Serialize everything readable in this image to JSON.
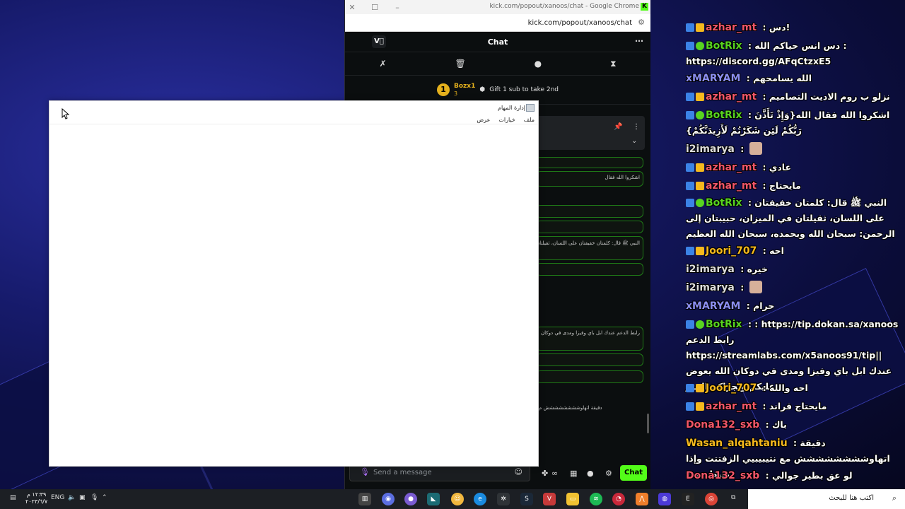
{
  "chrome": {
    "window_title": "kick.com/popout/xanoos/chat - Google Chrome",
    "url": "kick.com/popout/xanoos/chat"
  },
  "kick_chat": {
    "header_title": "Chat",
    "gift": {
      "rank": "1",
      "user": "Bozx1",
      "count": "3",
      "text": "Gift 1 sub to take 2nd"
    },
    "messages": [
      "اشكروا الله فقال",
      "النبي ﷺ قال: كلمتان خفيفتان على اللسان، ثقيلتان",
      "رابط الدعم عندك ابل باي وفيزا ومدى في دوكان",
      "دقيقة اتهاوشششششششش م"
    ],
    "input_placeholder": "Send a message",
    "send_label": "Chat"
  },
  "task_manager": {
    "title": "إدارة المهام",
    "menu": [
      "ملف",
      "خيارات",
      "عرض"
    ]
  },
  "overlay_chat": [
    {
      "user": "azhar_mt",
      "color": "#f2566a",
      "badges": [
        "b1",
        "b2"
      ],
      "text": "دس!"
    },
    {
      "user": "BotRix",
      "color": "#58d420",
      "badges": [
        "b1",
        "b3"
      ],
      "text": "دس انس حياكم الله : https://discord.gg/AFqCtzxE5"
    },
    {
      "user": "xMARYAM",
      "color": "#8b8ef0",
      "badges": [],
      "text": "الله يسامحهم"
    },
    {
      "user": "azhar_mt",
      "color": "#f2566a",
      "badges": [
        "b1",
        "b2"
      ],
      "text": "نزلو ب روم الاديت التصاميم"
    },
    {
      "user": "BotRix",
      "color": "#58d420",
      "badges": [
        "b1",
        "b3"
      ],
      "text": "اشكروا الله فقال الله{وَإِذْ تَأَذَّنَ رَبُّكُمْ لَئِن شَكَرْتُمْ لَأَزِيدَنَّكُمْ}"
    },
    {
      "user": "i2imarya",
      "color": "#dcdcdc",
      "badges": [],
      "text": ""
    },
    {
      "user": "azhar_mt",
      "color": "#f2566a",
      "badges": [
        "b1",
        "b2"
      ],
      "text": "عادي"
    },
    {
      "user": "azhar_mt",
      "color": "#f2566a",
      "badges": [
        "b1",
        "b2"
      ],
      "text": "مايحتاج"
    },
    {
      "user": "BotRix",
      "color": "#58d420",
      "badges": [
        "b1",
        "b3"
      ],
      "text": "النبي ﷺ قال: كلمتان خفيفتان على اللسان، ثقيلتان في الميزان، حبيبتان إلى الرحمن: سبحان الله وبحمده، سبحان الله العظيم"
    },
    {
      "user": "Joori_707",
      "color": "#f6b91d",
      "badges": [
        "b1",
        "b2"
      ],
      "text": "احه"
    },
    {
      "user": "i2imarya",
      "color": "#dcdcdc",
      "badges": [],
      "text": "خيره"
    },
    {
      "user": "i2imarya",
      "color": "#dcdcdc",
      "badges": [],
      "text": ""
    },
    {
      "user": "xMARYAM",
      "color": "#8b8ef0",
      "badges": [],
      "text": "حرام"
    },
    {
      "user": "BotRix",
      "color": "#58d420",
      "badges": [
        "b1",
        "b3"
      ],
      "text": ": https://tip.dokan.sa/xanoos رابط الدعم https://streamlabs.com/x5anoos91/tip|| عندك ابل باي وفيزا ومدى في دوكان الله يعوض عليكم ويجزاكم الخير"
    },
    {
      "user": "Joori_707",
      "color": "#f6b91d",
      "badges": [
        "b1",
        "b2"
      ],
      "text": "احه والله"
    },
    {
      "user": "azhar_mt",
      "color": "#f2566a",
      "badges": [
        "b1",
        "b2"
      ],
      "text": "مايحتاج قراند"
    },
    {
      "user": "Dona132_sxb",
      "color": "#f2566a",
      "badges": [],
      "text": "باك"
    },
    {
      "user": "Wasan_alqahtaniu",
      "color": "#f6b91d",
      "badges": [],
      "text": "دقيقة اتهاوشششششششش مع نتيبيبيي الزفتتت وإذا طبط جيت"
    },
    {
      "user": "Dona132_sxb",
      "color": "#f2566a",
      "badges": [],
      "text": "لو عق بطير جوالي"
    }
  ],
  "taskbar": {
    "search_placeholder": "اكتب هنا للبحث",
    "lang": "ENG",
    "time": "١٢:٣٩ م",
    "date": "٢٠٢٣/٦/٧"
  }
}
